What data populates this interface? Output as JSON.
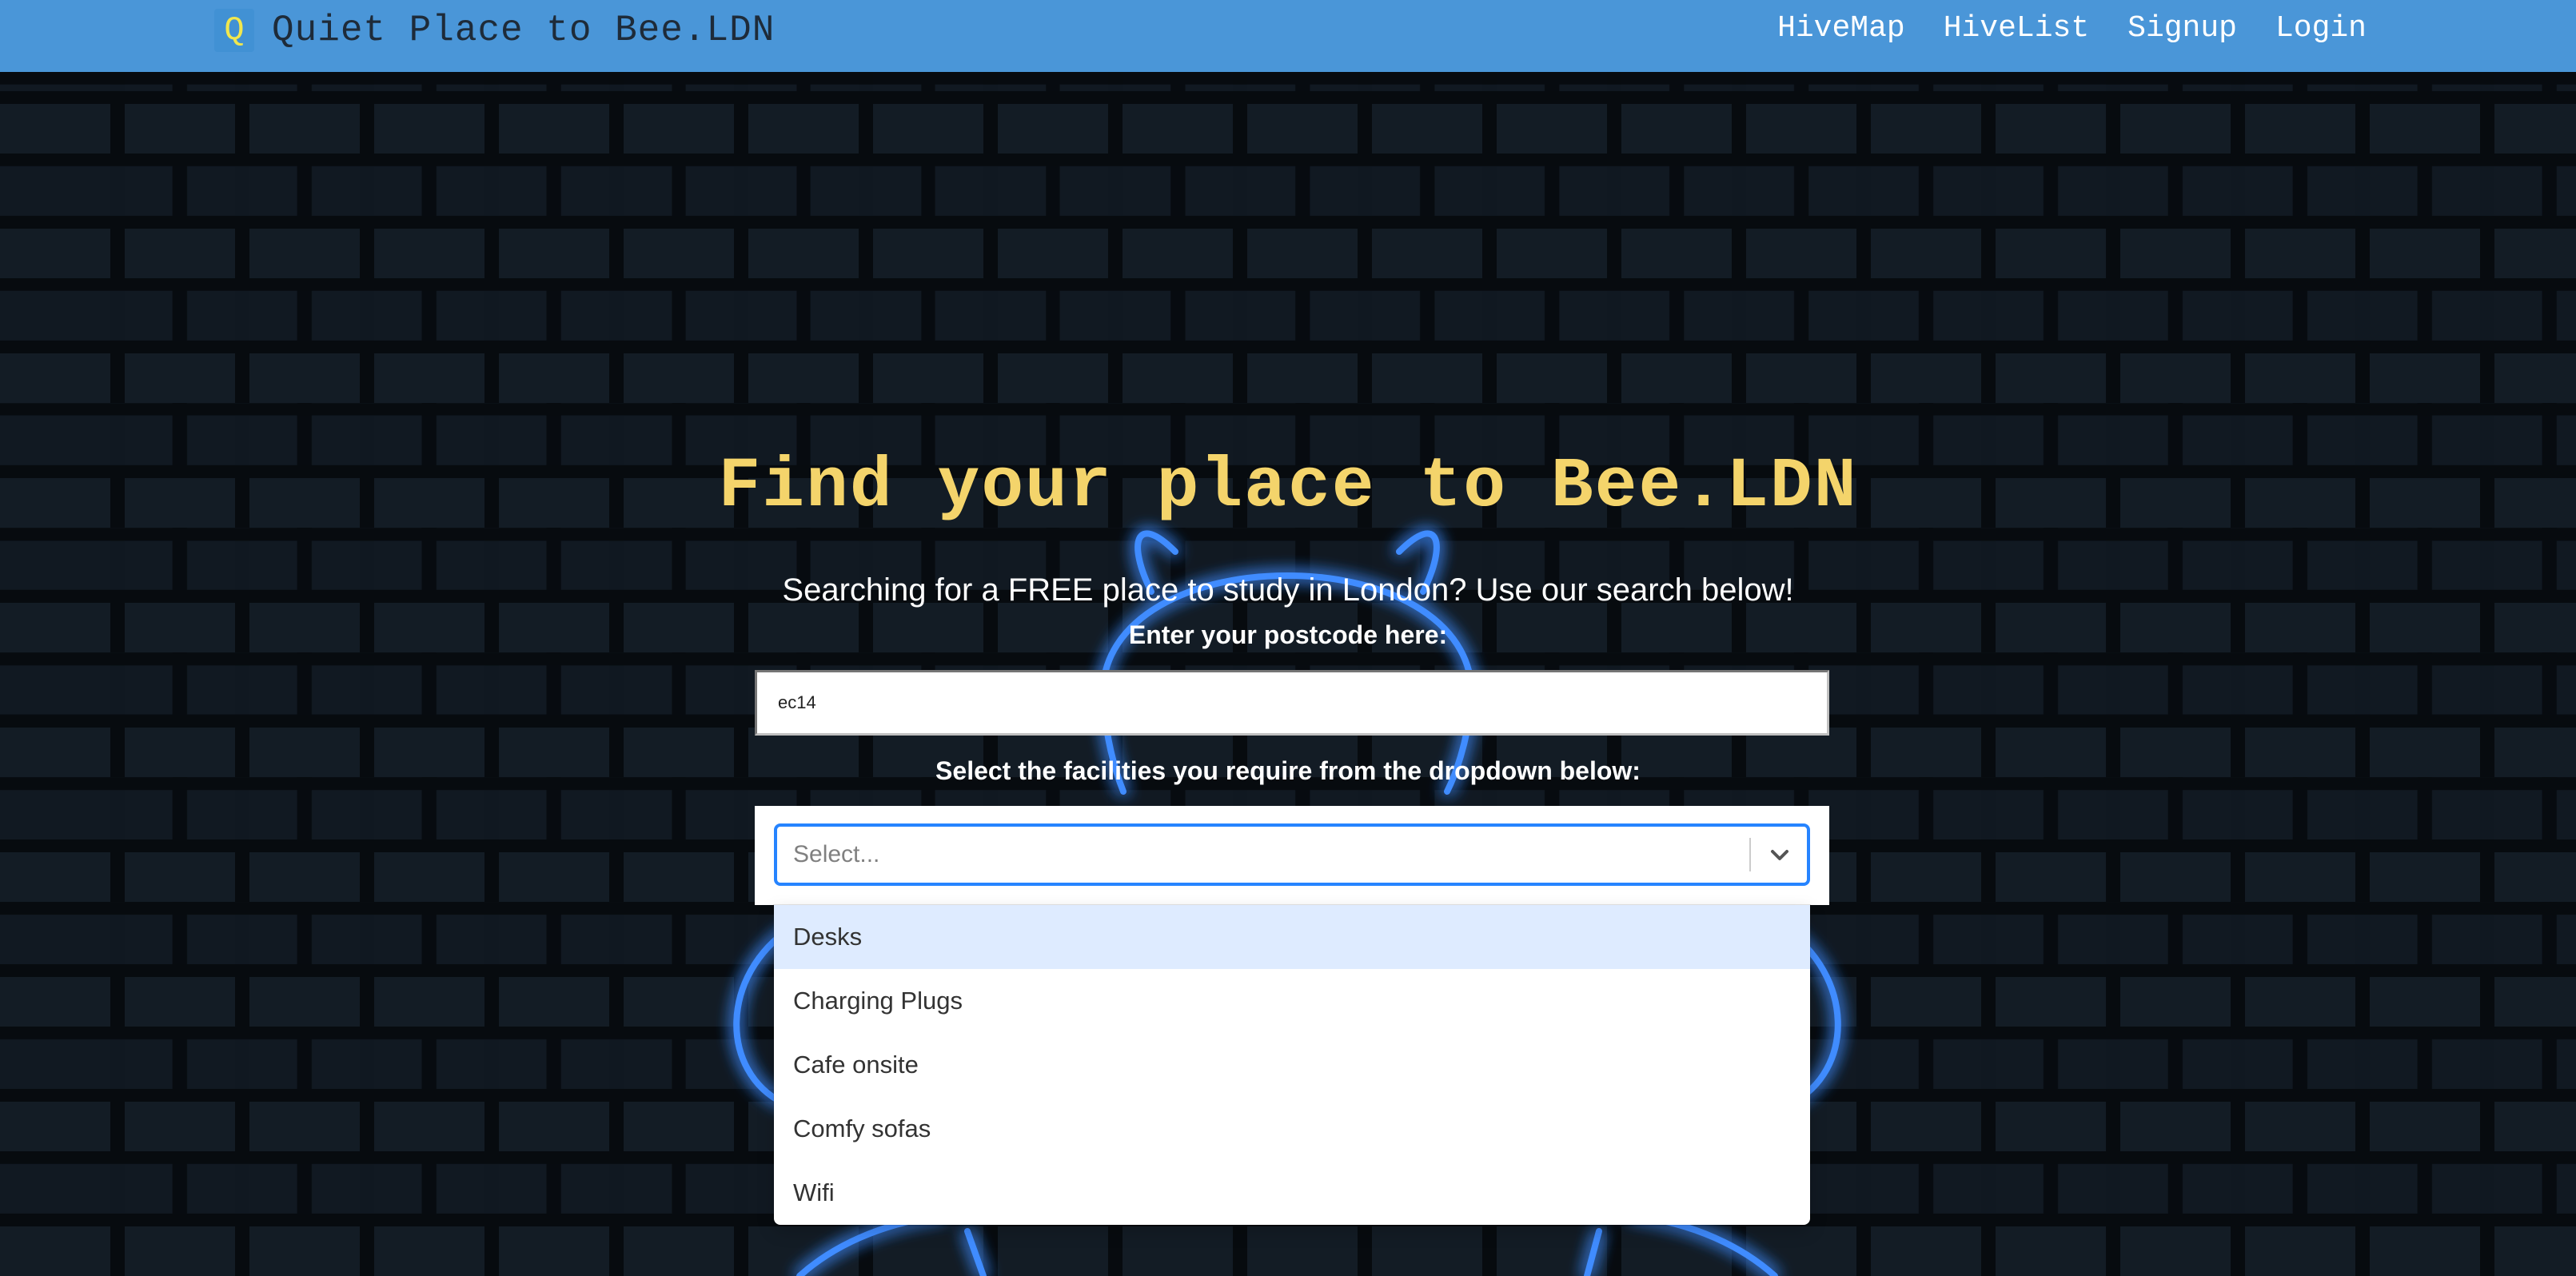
{
  "navbar": {
    "logo_letter": "Q",
    "brand": "Quiet Place to Bee.LDN",
    "links": [
      {
        "label": "HiveMap"
      },
      {
        "label": "HiveList"
      },
      {
        "label": "Signup"
      },
      {
        "label": "Login"
      }
    ]
  },
  "hero": {
    "title": "Find your place to Bee.LDN",
    "subtitle": "Searching for a FREE place to study in London? Use our search below!"
  },
  "search": {
    "postcode_label": "Enter your postcode here:",
    "postcode_value": "ec14",
    "facilities_label": "Select the facilities you require from the dropdown below:",
    "select_placeholder": "Select...",
    "options": [
      {
        "label": "Desks",
        "focused": true
      },
      {
        "label": "Charging Plugs",
        "focused": false
      },
      {
        "label": "Cafe onsite",
        "focused": false
      },
      {
        "label": "Comfy sofas",
        "focused": false
      },
      {
        "label": "Wifi",
        "focused": false
      }
    ]
  },
  "colors": {
    "navbar": "#4a96d8",
    "title": "#f4d46b",
    "select_focus": "#2684ff",
    "option_focus": "#deebff",
    "neon": "#3f8cff"
  },
  "icons": {
    "select_indicator": "chevron-down-icon",
    "background_art": "neon-bee-icon"
  }
}
